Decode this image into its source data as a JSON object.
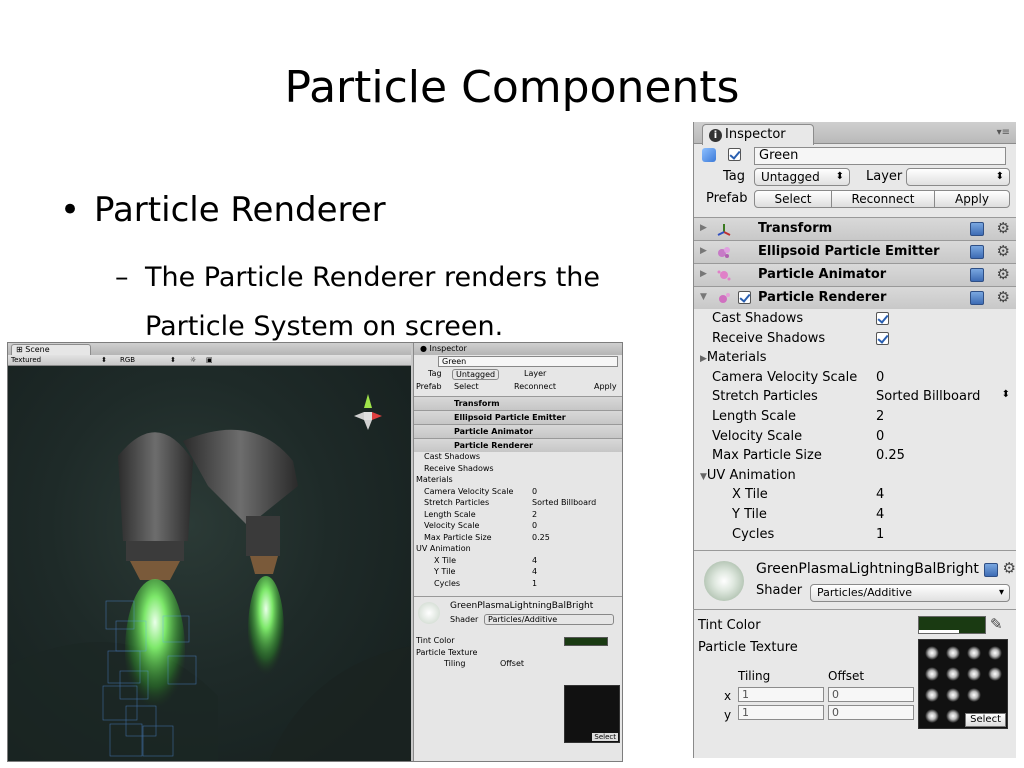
{
  "slide": {
    "title": "Particle Components",
    "bullet1": "Particle Renderer",
    "bullet2_line1": "The Particle Renderer renders the",
    "bullet2_line2": "Particle System on screen."
  },
  "inspector": {
    "tab_label": "Inspector",
    "object_name": "Green",
    "tag_label": "Tag",
    "tag_value": "Untagged",
    "layer_label": "Layer",
    "layer_value": "",
    "prefab_label": "Prefab",
    "prefab_select": "Select",
    "prefab_reconnect": "Reconnect",
    "prefab_apply": "Apply",
    "components": [
      {
        "name": "Transform",
        "icon": "transform-icon"
      },
      {
        "name": "Ellipsoid Particle Emitter",
        "icon": "emitter-icon"
      },
      {
        "name": "Particle Animator",
        "icon": "animator-icon"
      },
      {
        "name": "Particle Renderer",
        "icon": "renderer-icon"
      }
    ],
    "renderer_props": [
      {
        "label": "Cast Shadows",
        "value": ""
      },
      {
        "label": "Receive Shadows",
        "value": ""
      },
      {
        "label": "Materials",
        "value": ""
      },
      {
        "label": "Camera Velocity Scale",
        "value": "0"
      },
      {
        "label": "Stretch Particles",
        "value": "Sorted Billboard"
      },
      {
        "label": "Length Scale",
        "value": "2"
      },
      {
        "label": "Velocity Scale",
        "value": "0"
      },
      {
        "label": "Max Particle Size",
        "value": "0.25"
      },
      {
        "label": "UV Animation",
        "value": ""
      },
      {
        "label": "X Tile",
        "value": "4"
      },
      {
        "label": "Y Tile",
        "value": "4"
      },
      {
        "label": "Cycles",
        "value": "1"
      }
    ],
    "material_name": "GreenPlasmaLightningBalBright",
    "shader_label": "Shader",
    "shader_value": "Particles/Additive",
    "tint_color_label": "Tint Color",
    "tint_color": "#1a3a12",
    "particle_texture_label": "Particle Texture",
    "tiling_label": "Tiling",
    "offset_label": "Offset",
    "x_label": "x",
    "y_label": "y",
    "tiling_x": "1",
    "tiling_y": "1",
    "offset_x": "0",
    "offset_y": "0",
    "texture_select": "Select"
  },
  "scene": {
    "tab_label": "Scene",
    "render_mode": "Textured",
    "channel": "RGB",
    "mini_tab_label": "Inspector"
  }
}
